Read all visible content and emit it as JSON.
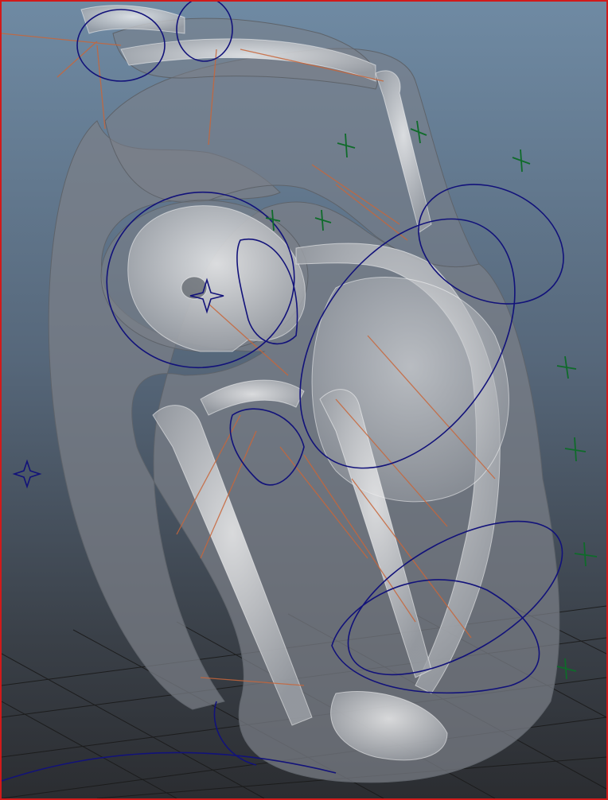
{
  "viewport": {
    "kind": "3d-perspective-viewport",
    "active_border_color": "#d11a1a",
    "background_top_color": "#6f8aa3",
    "background_bottom_color": "#2b2d31",
    "grid_color": "#1a1a1a"
  },
  "rig": {
    "skin_mesh_color": "#7b8088",
    "bone_color": "#cfcfcf",
    "ik_line_color": "#c8663a",
    "control_curve_color": "#12127a",
    "locator_color": "#0f6b2a"
  },
  "icons": [
    "star-locator-icon",
    "cross-locator-icon"
  ]
}
